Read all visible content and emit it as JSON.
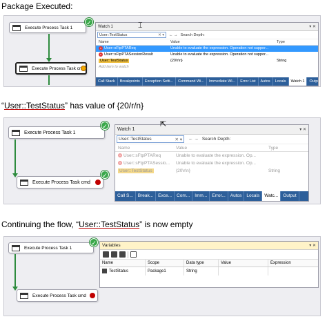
{
  "captions": {
    "first": "Package Executed:",
    "second_pre": "“",
    "second_ul": "User::TestStatus",
    "second_post": "” has value of {20/r/n}",
    "third_pre": "Continuing the flow, “",
    "third_ul": "User::TestStatus",
    "third_post": "” is now empty"
  },
  "panel1": {
    "task_top": "Execute Process Task 1",
    "task_bottom": "Execute Process Task cmd",
    "watch": {
      "title": "Watch 1",
      "controls": "▾ ✕",
      "search_value": "User::TestStatus",
      "search_depth_label": "Search Depth:",
      "columns": [
        "Name",
        "Value",
        "Type"
      ],
      "rows": [
        {
          "name": "User::sFtpPTAReq",
          "value": "Unable to evaluate the expression. Operation not suppor...",
          "type": ""
        },
        {
          "name": "User::sFtpPTASessionResult",
          "value": "Unable to evaluate the expression. Operation not suppor...",
          "type": ""
        },
        {
          "name": "User::TestStatus",
          "value": "{20\\r\\n}",
          "type": "String"
        }
      ],
      "add_item": "Add item to watch",
      "tabs": [
        "Call Stack",
        "Breakpoints",
        "Exception Setti...",
        "Command Wi...",
        "Immediate Wi...",
        "Error List",
        "Autos",
        "Locals",
        "Watch 1",
        "Output"
      ]
    }
  },
  "panel2": {
    "task_top": "Execute Process Task 1",
    "task_bottom": "Execute Process Task cmd",
    "watch": {
      "title": "Watch 1",
      "controls": "▾ ✕",
      "search_value": "User::TestStatus",
      "search_depth_label": "Search Depth:",
      "columns": [
        "Name",
        "Value",
        "Type"
      ],
      "rows": [
        {
          "name": "User::sFtpPTAReq",
          "value": "Unable to evaluate the expression. Op...",
          "type": ""
        },
        {
          "name": "User::sFtpPTASessio...",
          "value": "Unable to evaluate the expression. Op...",
          "type": ""
        },
        {
          "name": "User::TestStatus",
          "value": "{20\\r\\n}",
          "type": "String"
        }
      ],
      "tabs": [
        "Call S...",
        "Break...",
        "Exce...",
        "Com...",
        "Imm...",
        "Error...",
        "Autos",
        "Locals",
        "Watc...",
        "Output"
      ]
    }
  },
  "panel3": {
    "task_top": "Execute Process Task 1",
    "task_bottom": "Execute Process Task cmd",
    "variables": {
      "title": "Variables",
      "controls": "▾ ✕",
      "columns": [
        "Name",
        "Scope",
        "Data type",
        "Value",
        "Expression"
      ],
      "rows": [
        {
          "name": "TestStatus",
          "scope": "Package1",
          "data_type": "String",
          "value": "",
          "expression": ""
        }
      ]
    }
  },
  "colors": {
    "success": "#3aa84a",
    "breakpoint": "#c00000",
    "highlight": "#3399ff",
    "tabbar": "#2d5f9a"
  }
}
